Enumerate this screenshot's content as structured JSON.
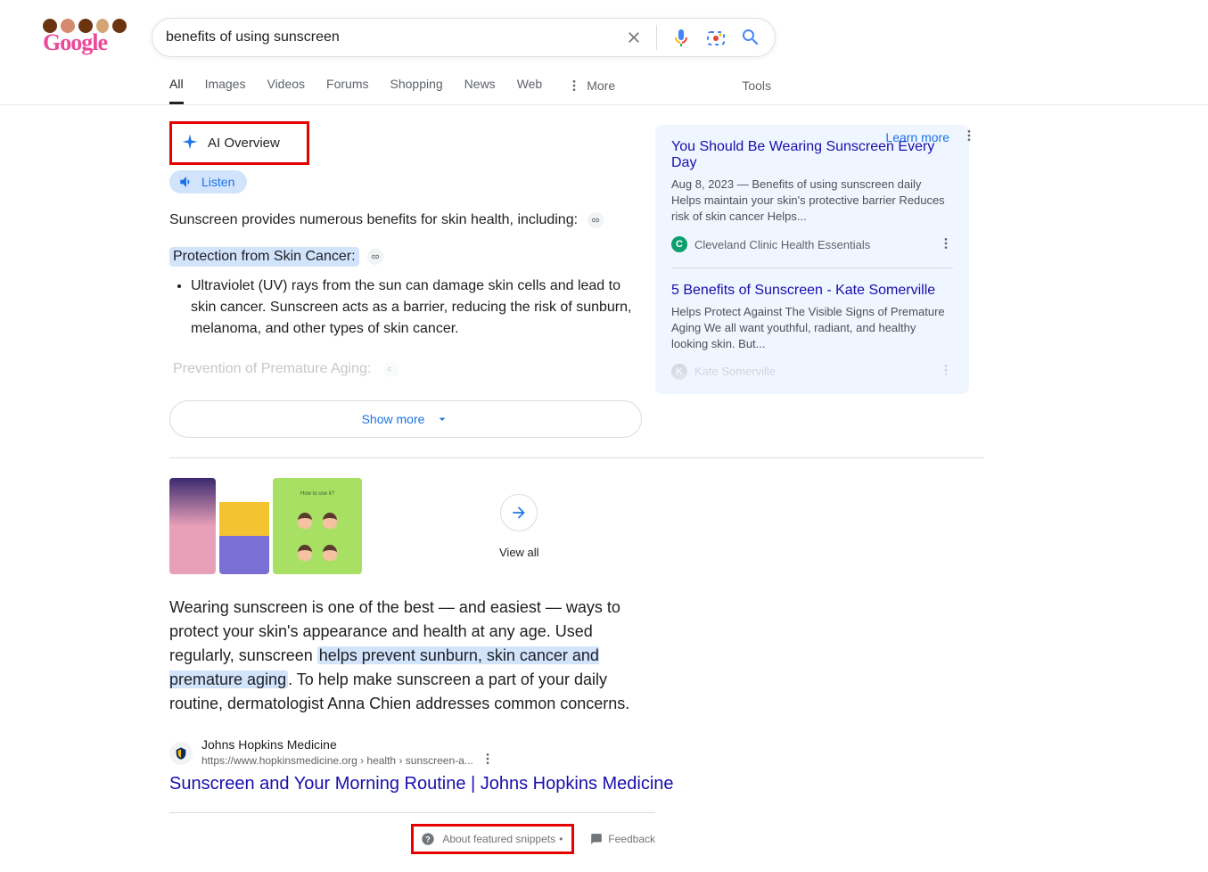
{
  "search": {
    "query": "benefits of using sunscreen"
  },
  "tabs": {
    "all": "All",
    "images": "Images",
    "videos": "Videos",
    "forums": "Forums",
    "shopping": "Shopping",
    "news": "News",
    "web": "Web",
    "more": "More",
    "tools": "Tools"
  },
  "ai_overview": {
    "label": "AI Overview",
    "learn_more": "Learn more",
    "listen": "Listen",
    "intro": "Sunscreen provides numerous benefits for skin health, including:",
    "section1_title": "Protection from Skin Cancer:",
    "section1_body": "Ultraviolet (UV) rays from the sun can damage skin cells and lead to skin cancer. Sunscreen acts as a barrier, reducing the risk of sunburn, melanoma, and other types of skin cancer.",
    "section2_title": "Prevention of Premature Aging:",
    "show_more": "Show more"
  },
  "snippets": [
    {
      "title": "You Should Be Wearing Sunscreen Every Day",
      "meta": "Aug 8, 2023 — Benefits of using sunscreen daily Helps maintain your skin's protective barrier Reduces risk of skin cancer Helps...",
      "source": "Cleveland Clinic Health Essentials"
    },
    {
      "title": "5 Benefits of Sunscreen - Kate Somerville",
      "meta": "Helps Protect Against The Visible Signs of Premature Aging We all want youthful, radiant, and healthy looking skin. But...",
      "source": "Kate Somerville"
    }
  ],
  "images": {
    "view_all": "View all",
    "thumb3_title": "How to use it?"
  },
  "featured": {
    "text_before": "Wearing sunscreen is one of the best — and easiest — ways to protect your skin's appearance and health at any age. Used regularly, sunscreen ",
    "text_highlight": "helps prevent sunburn, skin cancer and premature aging",
    "text_after": ". To help make sunscreen a part of your daily routine, dermatologist Anna Chien addresses common concerns.",
    "site": "Johns Hopkins Medicine",
    "url": "https://www.hopkinsmedicine.org › health › sunscreen-a...",
    "title": "Sunscreen and Your Morning Routine | Johns Hopkins Medicine"
  },
  "footer": {
    "about_snippets": "About featured snippets",
    "feedback": "Feedback"
  }
}
